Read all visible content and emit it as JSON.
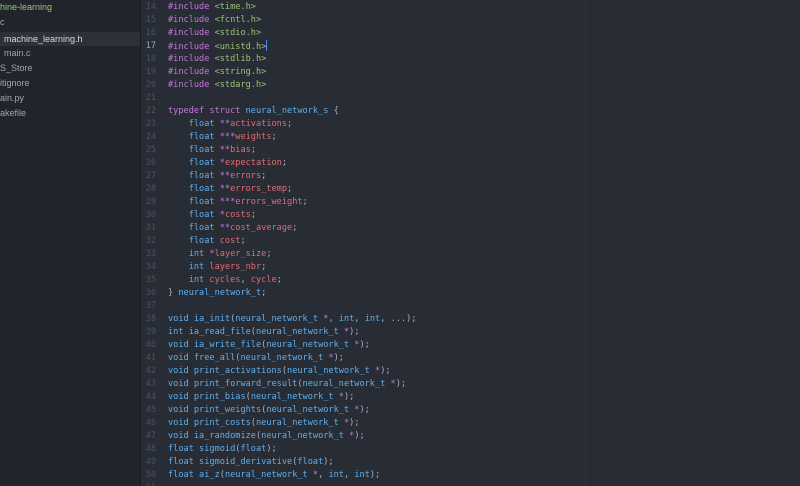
{
  "sidebar": {
    "items": [
      {
        "label": "hine-learning",
        "kind": "root"
      },
      {
        "label": "c",
        "kind": "folder"
      },
      {
        "label": "machine_learning.h",
        "kind": "file",
        "selected": true
      },
      {
        "label": "main.c",
        "kind": "file"
      },
      {
        "label": "S_Store",
        "kind": "file"
      },
      {
        "label": "itignore",
        "kind": "file"
      },
      {
        "label": "ain.py",
        "kind": "file"
      },
      {
        "label": "akefile",
        "kind": "file"
      }
    ]
  },
  "editor": {
    "current_line": 17,
    "lines": [
      {
        "n": "14",
        "tokens": [
          [
            "k",
            "#include "
          ],
          [
            "s",
            "<time.h>"
          ]
        ]
      },
      {
        "n": "15",
        "tokens": [
          [
            "k",
            "#include "
          ],
          [
            "s",
            "<fcntl.h>"
          ]
        ]
      },
      {
        "n": "16",
        "tokens": [
          [
            "k",
            "#include "
          ],
          [
            "s",
            "<stdio.h>"
          ]
        ]
      },
      {
        "n": "17",
        "tokens": [
          [
            "k",
            "#include "
          ],
          [
            "s",
            "<unistd.h>"
          ]
        ]
      },
      {
        "n": "18",
        "tokens": [
          [
            "k",
            "#include "
          ],
          [
            "s",
            "<stdlib.h>"
          ]
        ]
      },
      {
        "n": "19",
        "tokens": [
          [
            "k",
            "#include "
          ],
          [
            "s",
            "<string.h>"
          ]
        ]
      },
      {
        "n": "20",
        "tokens": [
          [
            "k",
            "#include "
          ],
          [
            "s",
            "<stdarg.h>"
          ]
        ]
      },
      {
        "n": "21",
        "tokens": []
      },
      {
        "n": "22",
        "tokens": [
          [
            "k",
            "typedef struct "
          ],
          [
            "t",
            "neural_network_s"
          ],
          [
            "p",
            " {"
          ]
        ]
      },
      {
        "n": "23",
        "tokens": [
          [
            "p",
            "    "
          ],
          [
            "t",
            "float "
          ],
          [
            "o",
            "**"
          ],
          [
            "v",
            "activations"
          ],
          [
            "p",
            ";"
          ]
        ]
      },
      {
        "n": "24",
        "tokens": [
          [
            "p",
            "    "
          ],
          [
            "t",
            "float "
          ],
          [
            "o",
            "***"
          ],
          [
            "v",
            "weights"
          ],
          [
            "p",
            ";"
          ]
        ]
      },
      {
        "n": "25",
        "tokens": [
          [
            "p",
            "    "
          ],
          [
            "t",
            "float "
          ],
          [
            "o",
            "**"
          ],
          [
            "v",
            "bias"
          ],
          [
            "p",
            ";"
          ]
        ]
      },
      {
        "n": "26",
        "tokens": [
          [
            "p",
            "    "
          ],
          [
            "t",
            "float "
          ],
          [
            "o",
            "*"
          ],
          [
            "v",
            "expectation"
          ],
          [
            "p",
            ";"
          ]
        ]
      },
      {
        "n": "27",
        "tokens": [
          [
            "p",
            "    "
          ],
          [
            "t",
            "float "
          ],
          [
            "o",
            "**"
          ],
          [
            "v",
            "errors"
          ],
          [
            "p",
            ";"
          ]
        ]
      },
      {
        "n": "28",
        "tokens": [
          [
            "p",
            "    "
          ],
          [
            "t",
            "float "
          ],
          [
            "o",
            "**"
          ],
          [
            "v",
            "errors_temp"
          ],
          [
            "p",
            ";"
          ]
        ]
      },
      {
        "n": "29",
        "tokens": [
          [
            "p",
            "    "
          ],
          [
            "t",
            "float "
          ],
          [
            "o",
            "***"
          ],
          [
            "v",
            "errors_weight"
          ],
          [
            "p",
            ";"
          ]
        ]
      },
      {
        "n": "30",
        "tokens": [
          [
            "p",
            "    "
          ],
          [
            "t",
            "float "
          ],
          [
            "o",
            "*"
          ],
          [
            "v",
            "costs"
          ],
          [
            "p",
            ";"
          ]
        ]
      },
      {
        "n": "31",
        "tokens": [
          [
            "p",
            "    "
          ],
          [
            "t",
            "float "
          ],
          [
            "o",
            "**"
          ],
          [
            "v",
            "cost_average"
          ],
          [
            "p",
            ";"
          ]
        ]
      },
      {
        "n": "32",
        "tokens": [
          [
            "p",
            "    "
          ],
          [
            "t",
            "float "
          ],
          [
            "v",
            "cost"
          ],
          [
            "p",
            ";"
          ]
        ]
      },
      {
        "n": "33",
        "tokens": [
          [
            "p",
            "    "
          ],
          [
            "t",
            "int "
          ],
          [
            "o",
            "*"
          ],
          [
            "v",
            "layer_size"
          ],
          [
            "p",
            ";"
          ]
        ]
      },
      {
        "n": "34",
        "tokens": [
          [
            "p",
            "    "
          ],
          [
            "t",
            "int "
          ],
          [
            "v",
            "layers_nbr"
          ],
          [
            "p",
            ";"
          ]
        ]
      },
      {
        "n": "35",
        "tokens": [
          [
            "p",
            "    "
          ],
          [
            "t",
            "int "
          ],
          [
            "v",
            "cycles"
          ],
          [
            "p",
            ", "
          ],
          [
            "v",
            "cycle"
          ],
          [
            "p",
            ";"
          ]
        ]
      },
      {
        "n": "36",
        "tokens": [
          [
            "p",
            "} "
          ],
          [
            "t",
            "neural_network_t"
          ],
          [
            "p",
            ";"
          ]
        ]
      },
      {
        "n": "37",
        "tokens": []
      },
      {
        "n": "38",
        "tokens": [
          [
            "t",
            "void "
          ],
          [
            "f",
            "ia_init"
          ],
          [
            "p",
            "("
          ],
          [
            "t",
            "neural_network_t "
          ],
          [
            "o",
            "*"
          ],
          [
            "p",
            ", "
          ],
          [
            "t",
            "int"
          ],
          [
            "p",
            ", "
          ],
          [
            "t",
            "int"
          ],
          [
            "p",
            ", ...);"
          ]
        ]
      },
      {
        "n": "39",
        "tokens": [
          [
            "t",
            "int "
          ],
          [
            "f",
            "ia_read_file"
          ],
          [
            "p",
            "("
          ],
          [
            "t",
            "neural_network_t "
          ],
          [
            "o",
            "*"
          ],
          [
            "p",
            ");"
          ]
        ]
      },
      {
        "n": "40",
        "tokens": [
          [
            "t",
            "void "
          ],
          [
            "f",
            "ia_write_file"
          ],
          [
            "p",
            "("
          ],
          [
            "t",
            "neural_network_t "
          ],
          [
            "o",
            "*"
          ],
          [
            "p",
            ");"
          ]
        ]
      },
      {
        "n": "41",
        "tokens": [
          [
            "t",
            "void "
          ],
          [
            "f",
            "free_all"
          ],
          [
            "p",
            "("
          ],
          [
            "t",
            "neural_network_t "
          ],
          [
            "o",
            "*"
          ],
          [
            "p",
            ");"
          ]
        ]
      },
      {
        "n": "42",
        "tokens": [
          [
            "t",
            "void "
          ],
          [
            "f",
            "print_activations"
          ],
          [
            "p",
            "("
          ],
          [
            "t",
            "neural_network_t "
          ],
          [
            "o",
            "*"
          ],
          [
            "p",
            ");"
          ]
        ]
      },
      {
        "n": "43",
        "tokens": [
          [
            "t",
            "void "
          ],
          [
            "f",
            "print_forward_result"
          ],
          [
            "p",
            "("
          ],
          [
            "t",
            "neural_network_t "
          ],
          [
            "o",
            "*"
          ],
          [
            "p",
            ");"
          ]
        ]
      },
      {
        "n": "44",
        "tokens": [
          [
            "t",
            "void "
          ],
          [
            "f",
            "print_bias"
          ],
          [
            "p",
            "("
          ],
          [
            "t",
            "neural_network_t "
          ],
          [
            "o",
            "*"
          ],
          [
            "p",
            ");"
          ]
        ]
      },
      {
        "n": "45",
        "tokens": [
          [
            "t",
            "void "
          ],
          [
            "f",
            "print_weights"
          ],
          [
            "p",
            "("
          ],
          [
            "t",
            "neural_network_t "
          ],
          [
            "o",
            "*"
          ],
          [
            "p",
            ");"
          ]
        ]
      },
      {
        "n": "46",
        "tokens": [
          [
            "t",
            "void "
          ],
          [
            "f",
            "print_costs"
          ],
          [
            "p",
            "("
          ],
          [
            "t",
            "neural_network_t "
          ],
          [
            "o",
            "*"
          ],
          [
            "p",
            ");"
          ]
        ]
      },
      {
        "n": "47",
        "tokens": [
          [
            "t",
            "void "
          ],
          [
            "f",
            "ia_randomize"
          ],
          [
            "p",
            "("
          ],
          [
            "t",
            "neural_network_t "
          ],
          [
            "o",
            "*"
          ],
          [
            "p",
            ");"
          ]
        ]
      },
      {
        "n": "48",
        "tokens": [
          [
            "t",
            "float "
          ],
          [
            "f",
            "sigmoid"
          ],
          [
            "p",
            "("
          ],
          [
            "t",
            "float"
          ],
          [
            "p",
            ");"
          ]
        ]
      },
      {
        "n": "49",
        "tokens": [
          [
            "t",
            "float "
          ],
          [
            "f",
            "sigmoid_derivative"
          ],
          [
            "p",
            "("
          ],
          [
            "t",
            "float"
          ],
          [
            "p",
            ");"
          ]
        ]
      },
      {
        "n": "50",
        "tokens": [
          [
            "t",
            "float "
          ],
          [
            "f",
            "ai_z"
          ],
          [
            "p",
            "("
          ],
          [
            "t",
            "neural_network_t "
          ],
          [
            "o",
            "*"
          ],
          [
            "p",
            ", "
          ],
          [
            "t",
            "int"
          ],
          [
            "p",
            ", "
          ],
          [
            "t",
            "int"
          ],
          [
            "p",
            ");"
          ]
        ]
      },
      {
        "n": "51",
        "tokens": []
      }
    ]
  }
}
